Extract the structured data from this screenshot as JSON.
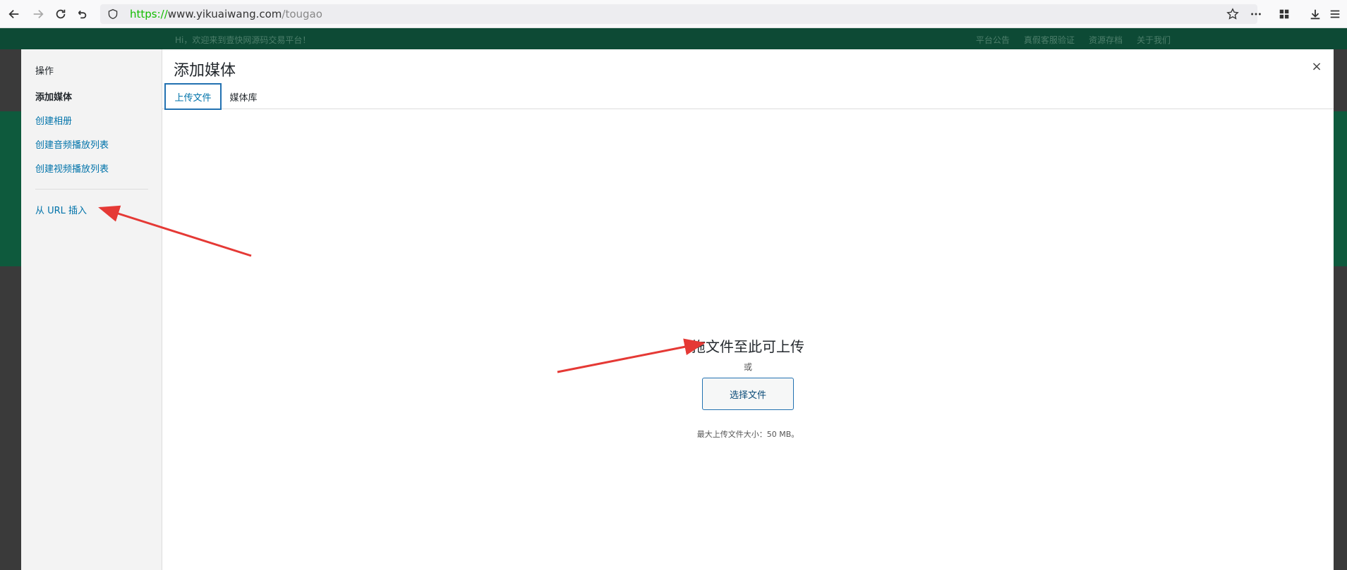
{
  "browser": {
    "url_scheme": "https://",
    "url_host": "www.yikuaiwang.com",
    "url_path": "/tougao"
  },
  "site": {
    "greeting": "Hi，欢迎来到壹快网源码交易平台！",
    "links": [
      "平台公告",
      "真假客服验证",
      "资源存档",
      "关于我们"
    ]
  },
  "sidebar": {
    "heading": "操作",
    "items": [
      {
        "label": "添加媒体"
      },
      {
        "label": "创建相册"
      },
      {
        "label": "创建音频播放列表"
      },
      {
        "label": "创建视频播放列表"
      },
      {
        "label": "从 URL 插入"
      }
    ]
  },
  "modal": {
    "title": "添加媒体",
    "close": "×",
    "tabs": [
      {
        "label": "上传文件"
      },
      {
        "label": "媒体库"
      }
    ]
  },
  "upload": {
    "drop_title": "拖文件至此可上传",
    "or": "或",
    "select_button": "选择文件",
    "max_size": "最大上传文件大小：50 MB。"
  },
  "colors": {
    "accent": "#0073aa",
    "annotation_arrow": "#e53935",
    "site_green": "#0d4a35"
  }
}
